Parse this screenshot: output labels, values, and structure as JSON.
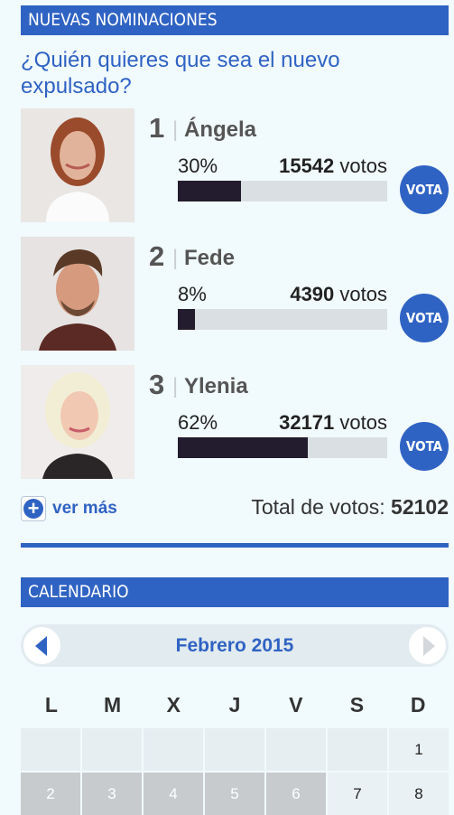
{
  "nominations": {
    "header": "NUEVAS NOMINACIONES",
    "question": "¿Quién quieres que sea el nuevo expulsado?",
    "vote_button_label": "VOTA",
    "votes_suffix": "votos",
    "nominees": [
      {
        "rank": "1",
        "name": "Ángela",
        "percent": "30%",
        "votes": "15542",
        "share": 0.3
      },
      {
        "rank": "2",
        "name": "Fede",
        "percent": "8%",
        "votes": "4390",
        "share": 0.08
      },
      {
        "rank": "3",
        "name": "Ylenia",
        "percent": "62%",
        "votes": "32171",
        "share": 0.62
      }
    ],
    "see_more_label": "ver más",
    "total_label": "Total de votos:",
    "total_value": "52102"
  },
  "calendar": {
    "header": "CALENDARIO",
    "month": "Febrero 2015",
    "weekdays": [
      "L",
      "M",
      "X",
      "J",
      "V",
      "S",
      "D"
    ],
    "row1": [
      "",
      "",
      "",
      "",
      "",
      "",
      "1"
    ],
    "row2": [
      "2",
      "3",
      "4",
      "5",
      "6",
      "7",
      "8"
    ]
  },
  "colors": {
    "accent": "#2f63c3",
    "bar_fill": "#231b2e",
    "bar_track": "#d9dfe2",
    "background": "#f1fafc"
  }
}
